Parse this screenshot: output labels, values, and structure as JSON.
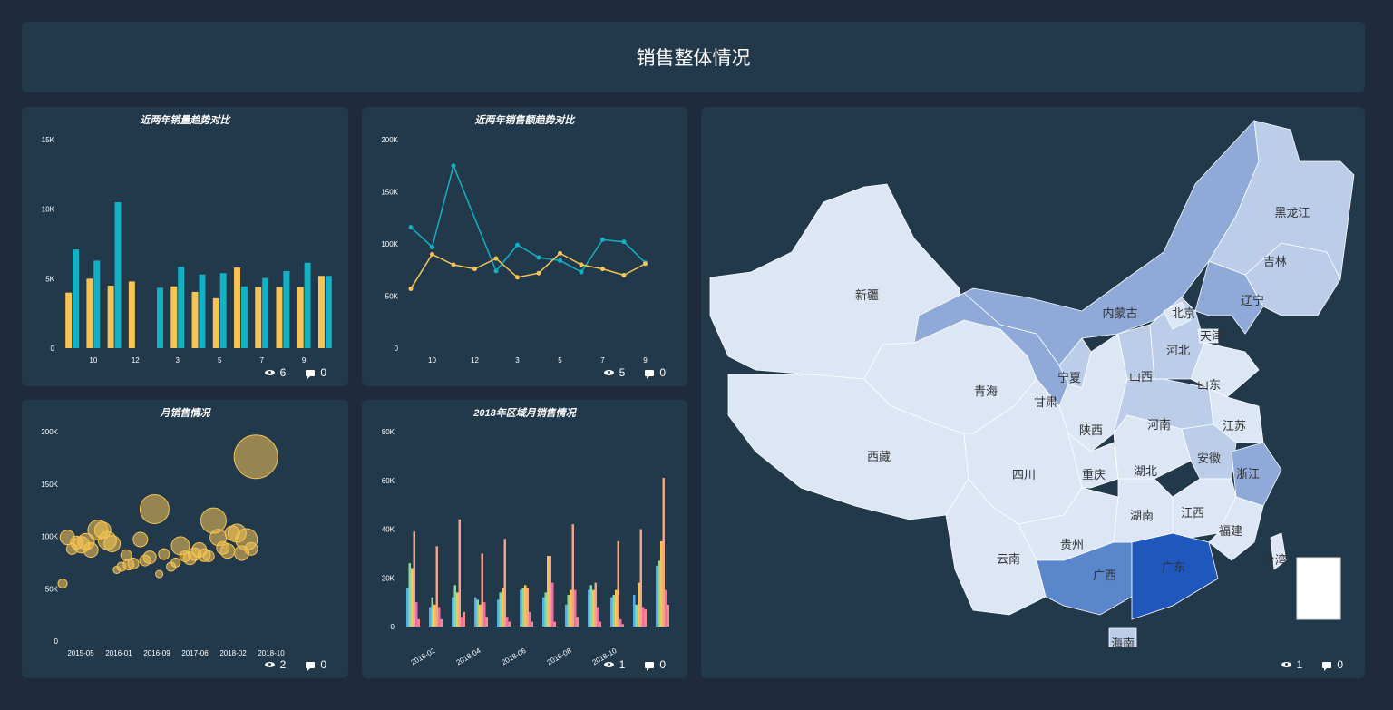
{
  "header": {
    "title": "销售整体情况"
  },
  "colors": {
    "teal": "#12b1c4",
    "yellow": "#f6c453",
    "bubble": "#f6c453",
    "red": "#f58a8a",
    "blue": "#4fb0e8",
    "green": "#8fd7a0",
    "pink": "#f26fa5",
    "peach": "#f0a58a"
  },
  "panels": [
    {
      "id": "p1",
      "title": "近两年销量趋势对比",
      "views": "6",
      "comments": "0"
    },
    {
      "id": "p2",
      "title": "近两年销售额趋势对比",
      "views": "5",
      "comments": "0"
    },
    {
      "id": "p3",
      "title": "月销售情况",
      "views": "2",
      "comments": "0"
    },
    {
      "id": "p4",
      "title": "2018年区域月销售情况",
      "views": "1",
      "comments": "0"
    },
    {
      "id": "p5",
      "title": "",
      "views": "1",
      "comments": "0"
    }
  ],
  "chart_data": [
    {
      "type": "bar",
      "title": "近两年销量趋势对比",
      "categories": [
        "9",
        "10",
        "11",
        "12",
        "1",
        "2",
        "3",
        "4",
        "5",
        "6",
        "7",
        "8",
        "9"
      ],
      "tick_labels": [
        "10",
        "12",
        "3",
        "5",
        "7",
        "9"
      ],
      "y_ticks": [
        "0",
        "5K",
        "10K",
        "15K"
      ],
      "ylim": [
        0,
        15000
      ],
      "series": [
        {
          "color_key": "yellow",
          "values": [
            4000,
            5000,
            4500,
            4800,
            0,
            4450,
            4050,
            3600,
            5800,
            4400,
            4400,
            4400,
            5200
          ]
        },
        {
          "color_key": "teal",
          "values": [
            7100,
            6300,
            10500,
            0,
            4350,
            5850,
            5300,
            5400,
            4450,
            5050,
            5550,
            6150,
            5200
          ]
        }
      ]
    },
    {
      "type": "line",
      "title": "近两年销售额趋势对比",
      "categories": [
        "9",
        "10",
        "11",
        "12",
        "1",
        "2",
        "3",
        "4",
        "5",
        "6",
        "7",
        "8",
        "9"
      ],
      "tick_labels": [
        "10",
        "12",
        "3",
        "5",
        "7",
        "9"
      ],
      "y_ticks": [
        "0",
        "50K",
        "100K",
        "150K",
        "200K"
      ],
      "ylim": [
        0,
        200000
      ],
      "series": [
        {
          "color_key": "teal",
          "values": [
            116000,
            97000,
            175000,
            0,
            74000,
            99000,
            87000,
            84000,
            73000,
            104000,
            102000,
            82000,
            null
          ]
        },
        {
          "color_key": "yellow",
          "values": [
            57000,
            90000,
            80000,
            76000,
            86000,
            68000,
            72000,
            91000,
            80000,
            76000,
            70000,
            81000,
            null
          ]
        }
      ]
    },
    {
      "type": "scatter",
      "title": "月销售情况",
      "x_ticks": [
        "2015-05",
        "2016-01",
        "2016-09",
        "2017-06",
        "2018-02",
        "2018-10"
      ],
      "y_ticks": [
        "0",
        "50K",
        "100K",
        "150K",
        "200K"
      ],
      "ylim": [
        0,
        200000
      ],
      "points": [
        {
          "t": 0.0,
          "v": 55000,
          "r": 5
        },
        {
          "t": 0.02,
          "v": 99000,
          "r": 8
        },
        {
          "t": 0.04,
          "v": 88000,
          "r": 6
        },
        {
          "t": 0.06,
          "v": 94000,
          "r": 7
        },
        {
          "t": 0.08,
          "v": 92000,
          "r": 9
        },
        {
          "t": 0.1,
          "v": 95000,
          "r": 9
        },
        {
          "t": 0.12,
          "v": 87000,
          "r": 8
        },
        {
          "t": 0.15,
          "v": 106000,
          "r": 11
        },
        {
          "t": 0.17,
          "v": 106000,
          "r": 9
        },
        {
          "t": 0.19,
          "v": 96000,
          "r": 10
        },
        {
          "t": 0.21,
          "v": 93000,
          "r": 9
        },
        {
          "t": 0.23,
          "v": 68000,
          "r": 4
        },
        {
          "t": 0.25,
          "v": 71000,
          "r": 5
        },
        {
          "t": 0.27,
          "v": 82000,
          "r": 6
        },
        {
          "t": 0.28,
          "v": 73000,
          "r": 6
        },
        {
          "t": 0.3,
          "v": 74000,
          "r": 6
        },
        {
          "t": 0.33,
          "v": 97000,
          "r": 8
        },
        {
          "t": 0.35,
          "v": 77000,
          "r": 6
        },
        {
          "t": 0.37,
          "v": 80000,
          "r": 7
        },
        {
          "t": 0.39,
          "v": 126000,
          "r": 16
        },
        {
          "t": 0.41,
          "v": 64000,
          "r": 4
        },
        {
          "t": 0.43,
          "v": 83000,
          "r": 6
        },
        {
          "t": 0.46,
          "v": 71000,
          "r": 5
        },
        {
          "t": 0.48,
          "v": 75000,
          "r": 5
        },
        {
          "t": 0.5,
          "v": 91000,
          "r": 10
        },
        {
          "t": 0.52,
          "v": 81000,
          "r": 6
        },
        {
          "t": 0.54,
          "v": 79000,
          "r": 7
        },
        {
          "t": 0.56,
          "v": 83000,
          "r": 7
        },
        {
          "t": 0.58,
          "v": 87000,
          "r": 8
        },
        {
          "t": 0.6,
          "v": 82000,
          "r": 7
        },
        {
          "t": 0.62,
          "v": 81000,
          "r": 6
        },
        {
          "t": 0.64,
          "v": 115000,
          "r": 14
        },
        {
          "t": 0.66,
          "v": 99000,
          "r": 9
        },
        {
          "t": 0.68,
          "v": 89000,
          "r": 7
        },
        {
          "t": 0.7,
          "v": 86000,
          "r": 8
        },
        {
          "t": 0.72,
          "v": 103000,
          "r": 8
        },
        {
          "t": 0.74,
          "v": 103000,
          "r": 10
        },
        {
          "t": 0.76,
          "v": 84000,
          "r": 8
        },
        {
          "t": 0.78,
          "v": 97000,
          "r": 12
        },
        {
          "t": 0.8,
          "v": 88000,
          "r": 7
        },
        {
          "t": 0.82,
          "v": 176000,
          "r": 24
        }
      ]
    },
    {
      "type": "bar",
      "title": "2018年区域月销售情况",
      "categories": [
        "2018-01",
        "2018-02",
        "2018-03",
        "2018-04",
        "2018-05",
        "2018-06",
        "2018-07",
        "2018-08",
        "2018-09",
        "2018-10",
        "2018-11",
        "2018-12"
      ],
      "tick_labels": [
        "2018-02",
        "2018-04",
        "2018-06",
        "2018-08",
        "2018-10"
      ],
      "y_ticks": [
        "0",
        "20K",
        "40K",
        "60K",
        "80K"
      ],
      "ylim": [
        0,
        80000
      ],
      "series": [
        {
          "color_key": "blue",
          "values": [
            16000,
            8000,
            12000,
            12000,
            11000,
            15000,
            12000,
            9000,
            15000,
            12000,
            13000,
            25000
          ]
        },
        {
          "color_key": "green",
          "values": [
            26000,
            12000,
            17000,
            11000,
            14000,
            16000,
            14000,
            13000,
            17000,
            13000,
            9000,
            27000
          ]
        },
        {
          "color_key": "yellow",
          "values": [
            24000,
            9000,
            14000,
            9000,
            16000,
            17000,
            29000,
            15000,
            15000,
            15000,
            18000,
            35000
          ]
        },
        {
          "color_key": "peach",
          "values": [
            39000,
            33000,
            44000,
            30000,
            36000,
            16000,
            29000,
            42000,
            18000,
            35000,
            40000,
            61000
          ]
        },
        {
          "color_key": "pink",
          "values": [
            10000,
            8000,
            4000,
            10000,
            4000,
            6000,
            18000,
            15000,
            8000,
            3000,
            8000,
            15000
          ]
        },
        {
          "color_key": "red",
          "values": [
            3000,
            3000,
            6000,
            4000,
            2000,
            2000,
            2000,
            4000,
            2000,
            1000,
            7000,
            9000
          ]
        }
      ]
    }
  ],
  "map": {
    "provinces": [
      {
        "name": "新疆",
        "level": 0
      },
      {
        "name": "西藏",
        "level": 0
      },
      {
        "name": "青海",
        "level": 0
      },
      {
        "name": "甘肃",
        "level": 2
      },
      {
        "name": "内蒙古",
        "level": 2
      },
      {
        "name": "宁夏",
        "level": 1
      },
      {
        "name": "陕西",
        "level": 0
      },
      {
        "name": "四川",
        "level": 0
      },
      {
        "name": "重庆",
        "level": 0
      },
      {
        "name": "云南",
        "level": 0
      },
      {
        "name": "贵州",
        "level": 0
      },
      {
        "name": "广西",
        "level": 3
      },
      {
        "name": "广东",
        "level": 4
      },
      {
        "name": "海南",
        "level": 1
      },
      {
        "name": "湖南",
        "level": 0
      },
      {
        "name": "湖北",
        "level": 0
      },
      {
        "name": "河南",
        "level": 1
      },
      {
        "name": "山西",
        "level": 1
      },
      {
        "name": "河北",
        "level": 1
      },
      {
        "name": "北京",
        "level": 0
      },
      {
        "name": "天津",
        "level": 0
      },
      {
        "name": "山东",
        "level": 0
      },
      {
        "name": "江苏",
        "level": 0
      },
      {
        "name": "安徽",
        "level": 1
      },
      {
        "name": "浙江",
        "level": 2
      },
      {
        "name": "江西",
        "level": 0
      },
      {
        "name": "福建",
        "level": 0
      },
      {
        "name": "台湾",
        "level": 0
      },
      {
        "name": "辽宁",
        "level": 2
      },
      {
        "name": "吉林",
        "level": 1
      },
      {
        "name": "黑龙江",
        "level": 1
      }
    ],
    "level_colors": [
      "#dce6f4",
      "#bccde9",
      "#8faad8",
      "#5a86cc",
      "#2057bd"
    ]
  }
}
